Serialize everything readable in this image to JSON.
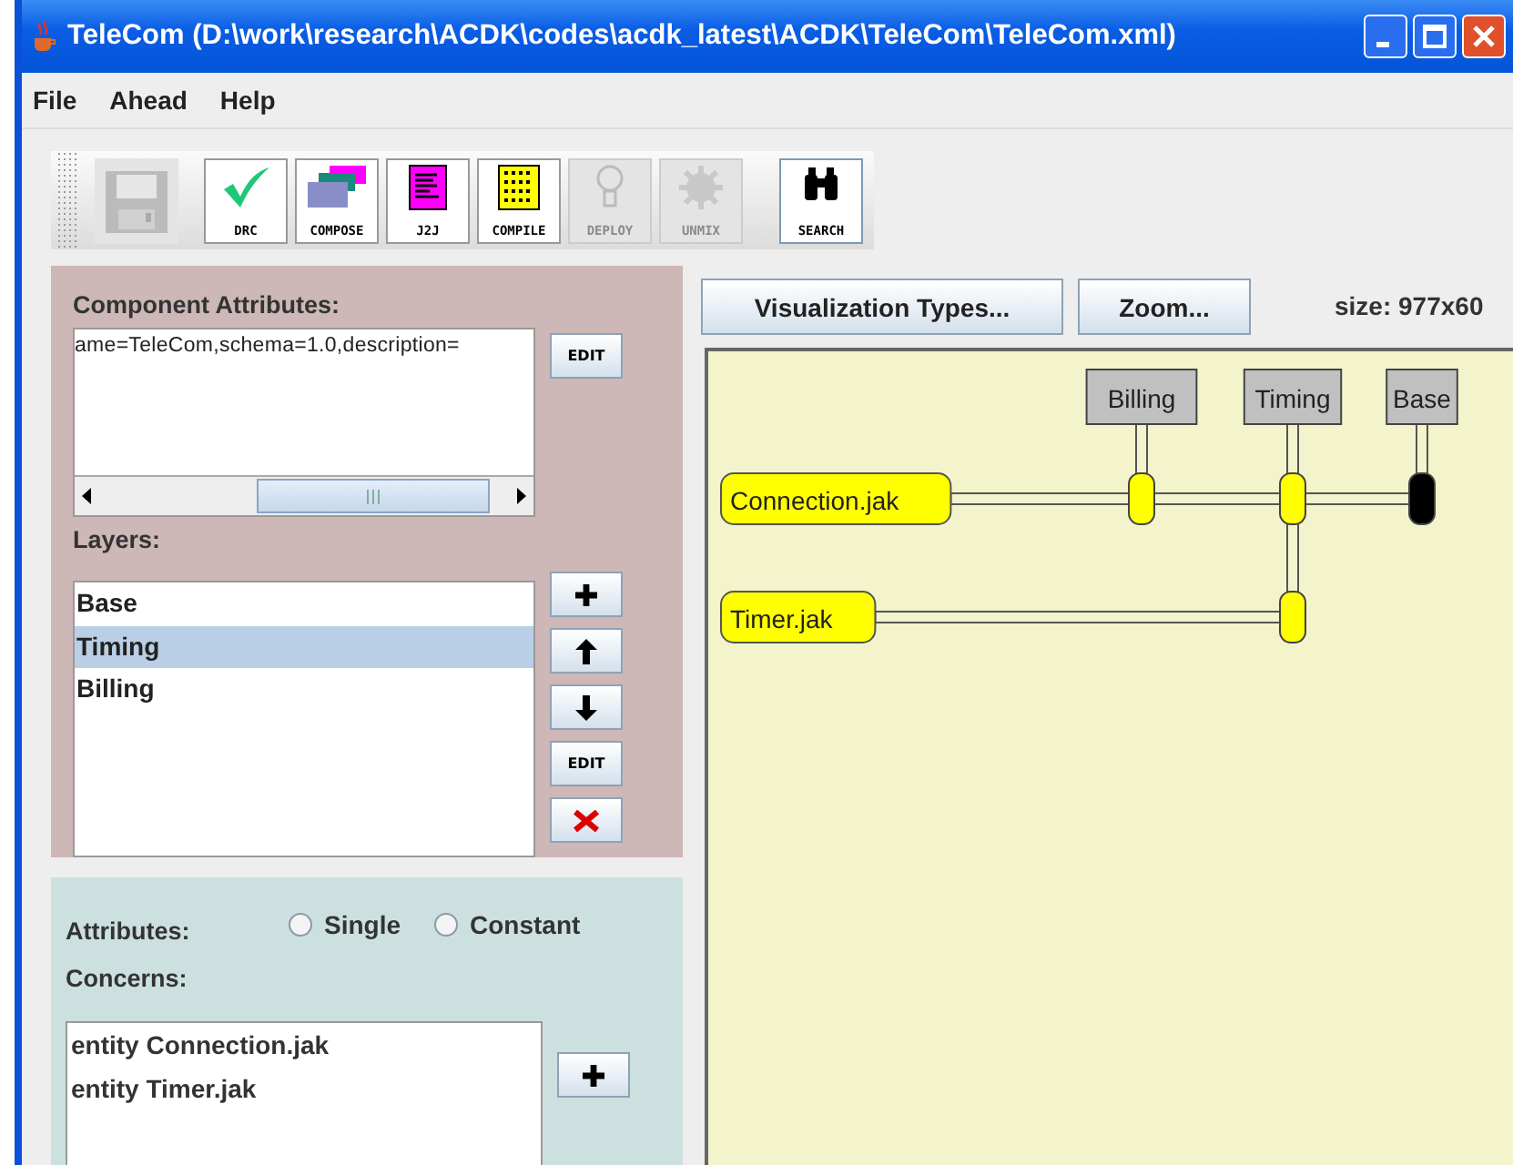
{
  "window": {
    "title": "TeleCom (D:\\work\\research\\ACDK\\codes\\acdk_latest\\ACDK\\TeleCom\\TeleCom.xml)"
  },
  "menu": [
    "File",
    "Ahead",
    "Help"
  ],
  "toolbar": [
    {
      "kind": "save",
      "disabled": true
    },
    {
      "kind": "drc",
      "label": "DRC",
      "disabled": false
    },
    {
      "kind": "compose",
      "label": "COMPOSE",
      "disabled": false
    },
    {
      "kind": "j2j",
      "label": "J2J",
      "disabled": false
    },
    {
      "kind": "compile",
      "label": "COMPILE",
      "disabled": false
    },
    {
      "kind": "deploy",
      "label": "DEPLOY",
      "disabled": true
    },
    {
      "kind": "unmix",
      "label": "UNMIX",
      "disabled": true
    },
    {
      "kind": "search",
      "label": "SEARCH",
      "disabled": false
    }
  ],
  "component_attributes": {
    "label": "Component Attributes:",
    "value": "ame=TeleCom,schema=1.0,description=",
    "edit_button": "EDIT"
  },
  "layers": {
    "label": "Layers:",
    "items": [
      {
        "name": "Base",
        "selected": false
      },
      {
        "name": "Timing",
        "selected": true
      },
      {
        "name": "Billing",
        "selected": false
      }
    ],
    "edit_button": "EDIT"
  },
  "attributes": {
    "label": "Attributes:",
    "options": [
      {
        "label": "Single",
        "checked": false
      },
      {
        "label": "Constant",
        "checked": false
      }
    ]
  },
  "concerns": {
    "label": "Concerns:",
    "items": [
      "entity Connection.jak",
      "entity Timer.jak"
    ]
  },
  "view_buttons": [
    "Visualization Types...",
    "Zoom..."
  ],
  "size_text": "size: 977x60",
  "diagram": {
    "layers": [
      "Billing",
      "Timing",
      "Base"
    ],
    "features": [
      {
        "name": "Connection.jak",
        "cells": [
          {
            "kind": "refine"
          },
          {
            "kind": "refine"
          },
          {
            "kind": "introduce"
          }
        ]
      },
      {
        "name": "Timer.jak",
        "cells": [
          {
            "kind": "none"
          },
          {
            "kind": "refine"
          },
          {
            "kind": "none"
          }
        ]
      }
    ]
  }
}
